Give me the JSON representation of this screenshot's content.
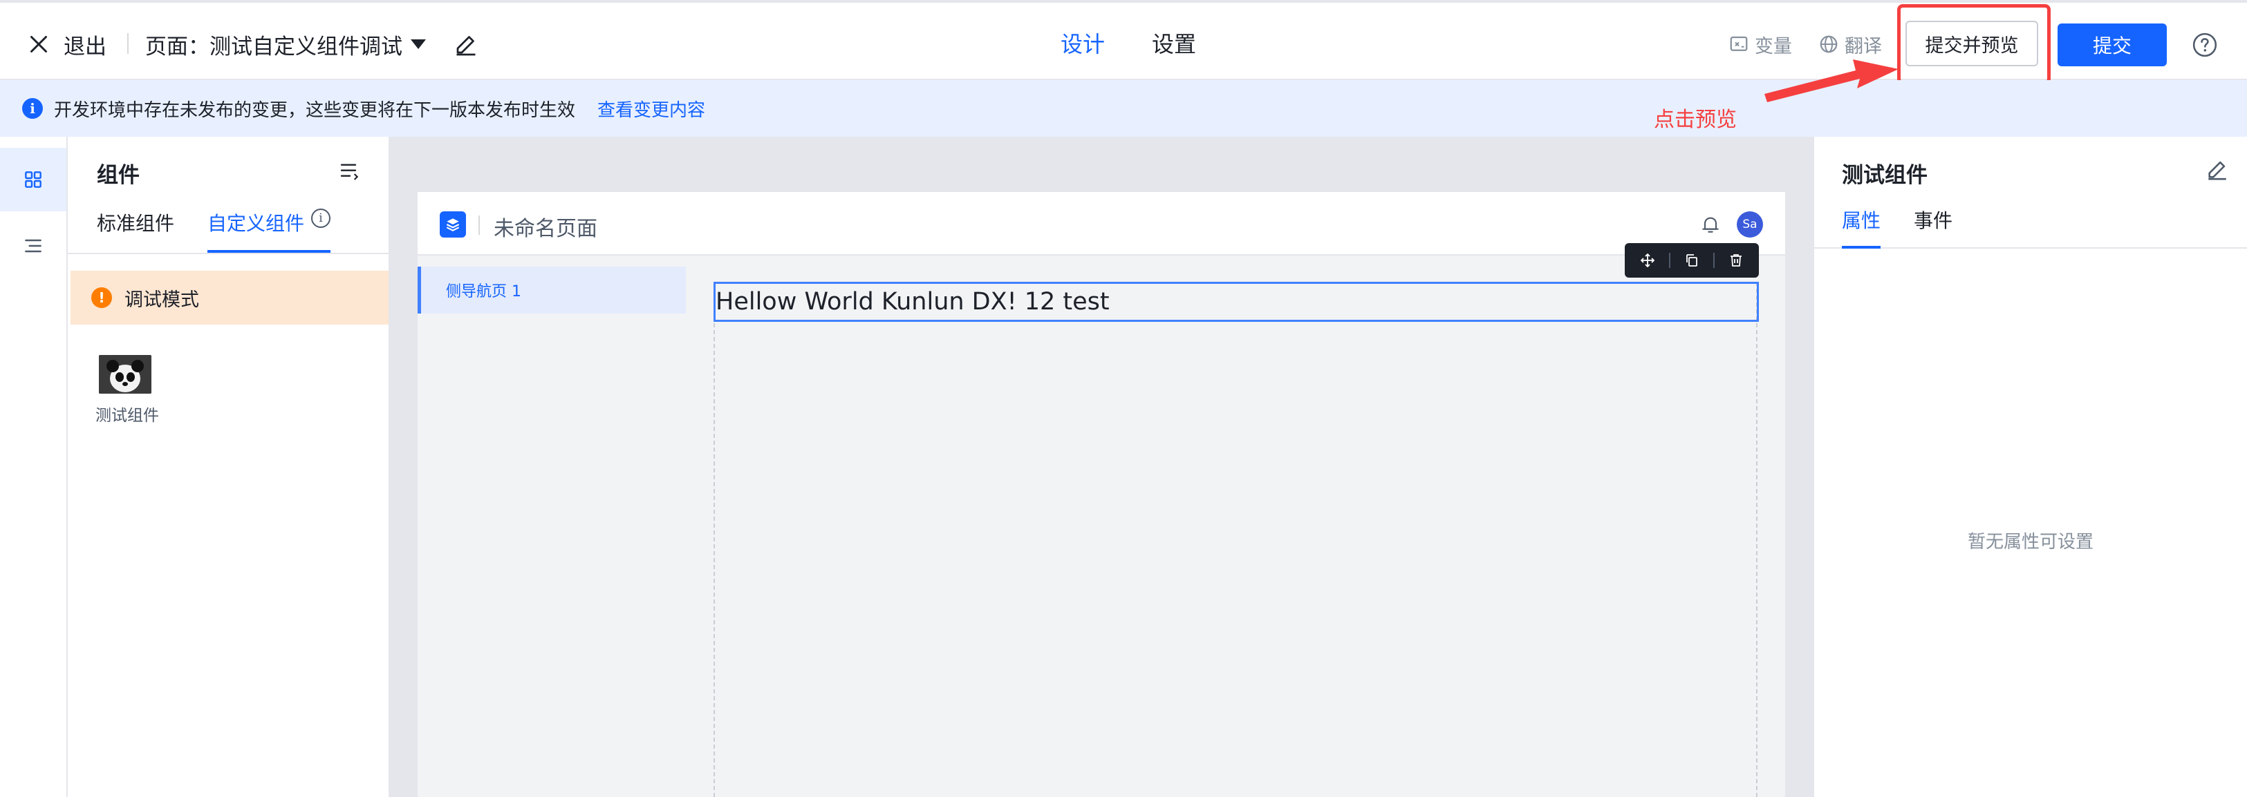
{
  "header": {
    "exit_label": "退出",
    "page_title": "页面：测试自定义组件调试",
    "tabs": [
      {
        "label": "设计",
        "active": true
      },
      {
        "label": "设置",
        "active": false
      }
    ],
    "variable_label": "变量",
    "translate_label": "翻译",
    "preview_button": "提交并预览",
    "submit_button": "提交"
  },
  "notice": {
    "message": "开发环境中存在未发布的变更，这些变更将在下一版本发布时生效",
    "link": "查看变更内容"
  },
  "annotation": {
    "text": "点击预览",
    "color": "#f53f3f"
  },
  "component_panel": {
    "title": "组件",
    "tabs": [
      {
        "label": "标准组件",
        "active": false
      },
      {
        "label": "自定义组件",
        "active": true
      }
    ],
    "debug_mode": "调试模式",
    "components": [
      {
        "name": "测试组件",
        "icon": "panda-thumbnail"
      }
    ]
  },
  "canvas": {
    "page_name": "未命名页面",
    "avatar_initials": "Sa",
    "side_nav_item": "侧导航页 1",
    "text_component": "Hellow World Kunlun DX! 12 test"
  },
  "props_panel": {
    "title": "测试组件",
    "tabs": [
      {
        "label": "属性",
        "active": true
      },
      {
        "label": "事件",
        "active": false
      }
    ],
    "empty_text": "暂无属性可设置"
  },
  "colors": {
    "primary": "#1664ff",
    "notice_bg": "#e8f0ff",
    "debug_bg": "#fde6d2",
    "warning": "#ff7d00",
    "annotation_red": "#f53f3f"
  }
}
